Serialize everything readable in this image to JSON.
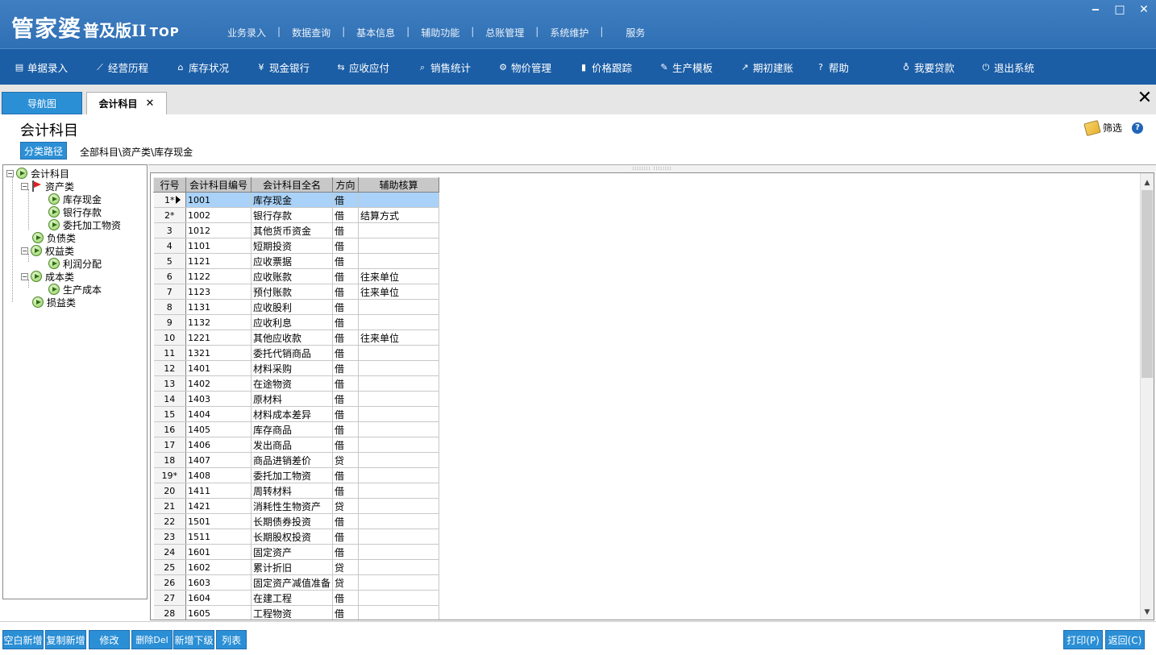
{
  "app": {
    "logo_main": "管家婆",
    "logo_sub": "普及版II",
    "logo_top": "TOP",
    "top_menu": [
      "业务录入",
      "数据查询",
      "基本信息",
      "辅助功能",
      "总账管理",
      "系统维护",
      "服务"
    ]
  },
  "toolbar": [
    {
      "icon": "document-icon",
      "label": "单据录入"
    },
    {
      "icon": "trend-icon",
      "label": "经营历程"
    },
    {
      "icon": "house-icon",
      "label": "库存状况"
    },
    {
      "icon": "yen-icon",
      "label": "现金银行"
    },
    {
      "icon": "transfer-icon",
      "label": "应收应付"
    },
    {
      "icon": "search-icon",
      "label": "销售统计"
    },
    {
      "icon": "gear-icon",
      "label": "物价管理"
    },
    {
      "icon": "bar-chart-icon",
      "label": "价格跟踪"
    },
    {
      "icon": "wrench-icon",
      "label": "生产模板"
    },
    {
      "icon": "export-icon",
      "label": "期初建账"
    },
    {
      "icon": "help-icon",
      "label": "帮助"
    },
    {
      "icon": "money-bag-icon",
      "label": "我要贷款"
    },
    {
      "icon": "power-icon",
      "label": "退出系统"
    }
  ],
  "tabs": {
    "nav_label": "导航图",
    "active_label": "会计科目"
  },
  "page": {
    "title": "会计科目",
    "path_button": "分类路径",
    "path": "全部科目\\资产类\\库存现金",
    "filter_label": "筛选"
  },
  "tree": {
    "root": "会计科目",
    "assets": "资产类",
    "cash": "库存现金",
    "bank": "银行存款",
    "processing": "委托加工物资",
    "liabilities": "负债类",
    "equity": "权益类",
    "profit": "利润分配",
    "cost": "成本类",
    "prod_cost": "生产成本",
    "pl": "损益类"
  },
  "grid": {
    "headers": [
      "行号",
      "会计科目编号",
      "会计科目全名",
      "方向",
      "辅助核算"
    ],
    "rows": [
      {
        "no": "1*",
        "code": "1001",
        "name": "库存现金",
        "dir": "借",
        "aux": ""
      },
      {
        "no": "2*",
        "code": "1002",
        "name": "银行存款",
        "dir": "借",
        "aux": "结算方式"
      },
      {
        "no": "3",
        "code": "1012",
        "name": "其他货币资金",
        "dir": "借",
        "aux": ""
      },
      {
        "no": "4",
        "code": "1101",
        "name": "短期投资",
        "dir": "借",
        "aux": ""
      },
      {
        "no": "5",
        "code": "1121",
        "name": "应收票据",
        "dir": "借",
        "aux": ""
      },
      {
        "no": "6",
        "code": "1122",
        "name": "应收账款",
        "dir": "借",
        "aux": "往来单位"
      },
      {
        "no": "7",
        "code": "1123",
        "name": "预付账款",
        "dir": "借",
        "aux": "往来单位"
      },
      {
        "no": "8",
        "code": "1131",
        "name": "应收股利",
        "dir": "借",
        "aux": ""
      },
      {
        "no": "9",
        "code": "1132",
        "name": "应收利息",
        "dir": "借",
        "aux": ""
      },
      {
        "no": "10",
        "code": "1221",
        "name": "其他应收款",
        "dir": "借",
        "aux": "往来单位"
      },
      {
        "no": "11",
        "code": "1321",
        "name": "委托代销商品",
        "dir": "借",
        "aux": ""
      },
      {
        "no": "12",
        "code": "1401",
        "name": "材料采购",
        "dir": "借",
        "aux": ""
      },
      {
        "no": "13",
        "code": "1402",
        "name": "在途物资",
        "dir": "借",
        "aux": ""
      },
      {
        "no": "14",
        "code": "1403",
        "name": "原材料",
        "dir": "借",
        "aux": ""
      },
      {
        "no": "15",
        "code": "1404",
        "name": "材料成本差异",
        "dir": "借",
        "aux": ""
      },
      {
        "no": "16",
        "code": "1405",
        "name": "库存商品",
        "dir": "借",
        "aux": ""
      },
      {
        "no": "17",
        "code": "1406",
        "name": "发出商品",
        "dir": "借",
        "aux": ""
      },
      {
        "no": "18",
        "code": "1407",
        "name": "商品进销差价",
        "dir": "贷",
        "aux": ""
      },
      {
        "no": "19*",
        "code": "1408",
        "name": "委托加工物资",
        "dir": "借",
        "aux": ""
      },
      {
        "no": "20",
        "code": "1411",
        "name": "周转材料",
        "dir": "借",
        "aux": ""
      },
      {
        "no": "21",
        "code": "1421",
        "name": "消耗性生物资产",
        "dir": "贷",
        "aux": ""
      },
      {
        "no": "22",
        "code": "1501",
        "name": "长期债券投资",
        "dir": "借",
        "aux": ""
      },
      {
        "no": "23",
        "code": "1511",
        "name": "长期股权投资",
        "dir": "借",
        "aux": ""
      },
      {
        "no": "24",
        "code": "1601",
        "name": "固定资产",
        "dir": "借",
        "aux": ""
      },
      {
        "no": "25",
        "code": "1602",
        "name": "累计折旧",
        "dir": "贷",
        "aux": ""
      },
      {
        "no": "26",
        "code": "1603",
        "name": "固定资产减值准备",
        "dir": "贷",
        "aux": ""
      },
      {
        "no": "27",
        "code": "1604",
        "name": "在建工程",
        "dir": "借",
        "aux": ""
      },
      {
        "no": "28",
        "code": "1605",
        "name": "工程物资",
        "dir": "借",
        "aux": ""
      }
    ]
  },
  "bottom": {
    "blank_new": "空白新增",
    "copy_new": "复制新增",
    "edit": "修改",
    "delete": "删除Del",
    "add_child": "新增下级",
    "list": "列表",
    "print": "打印(P)",
    "back": "返回(C)"
  },
  "colors": {
    "title_bar": "#3476ba",
    "toolbar": "#1b5ea6",
    "button": "#2b8fd6",
    "selected_row": "#aad2f8"
  }
}
